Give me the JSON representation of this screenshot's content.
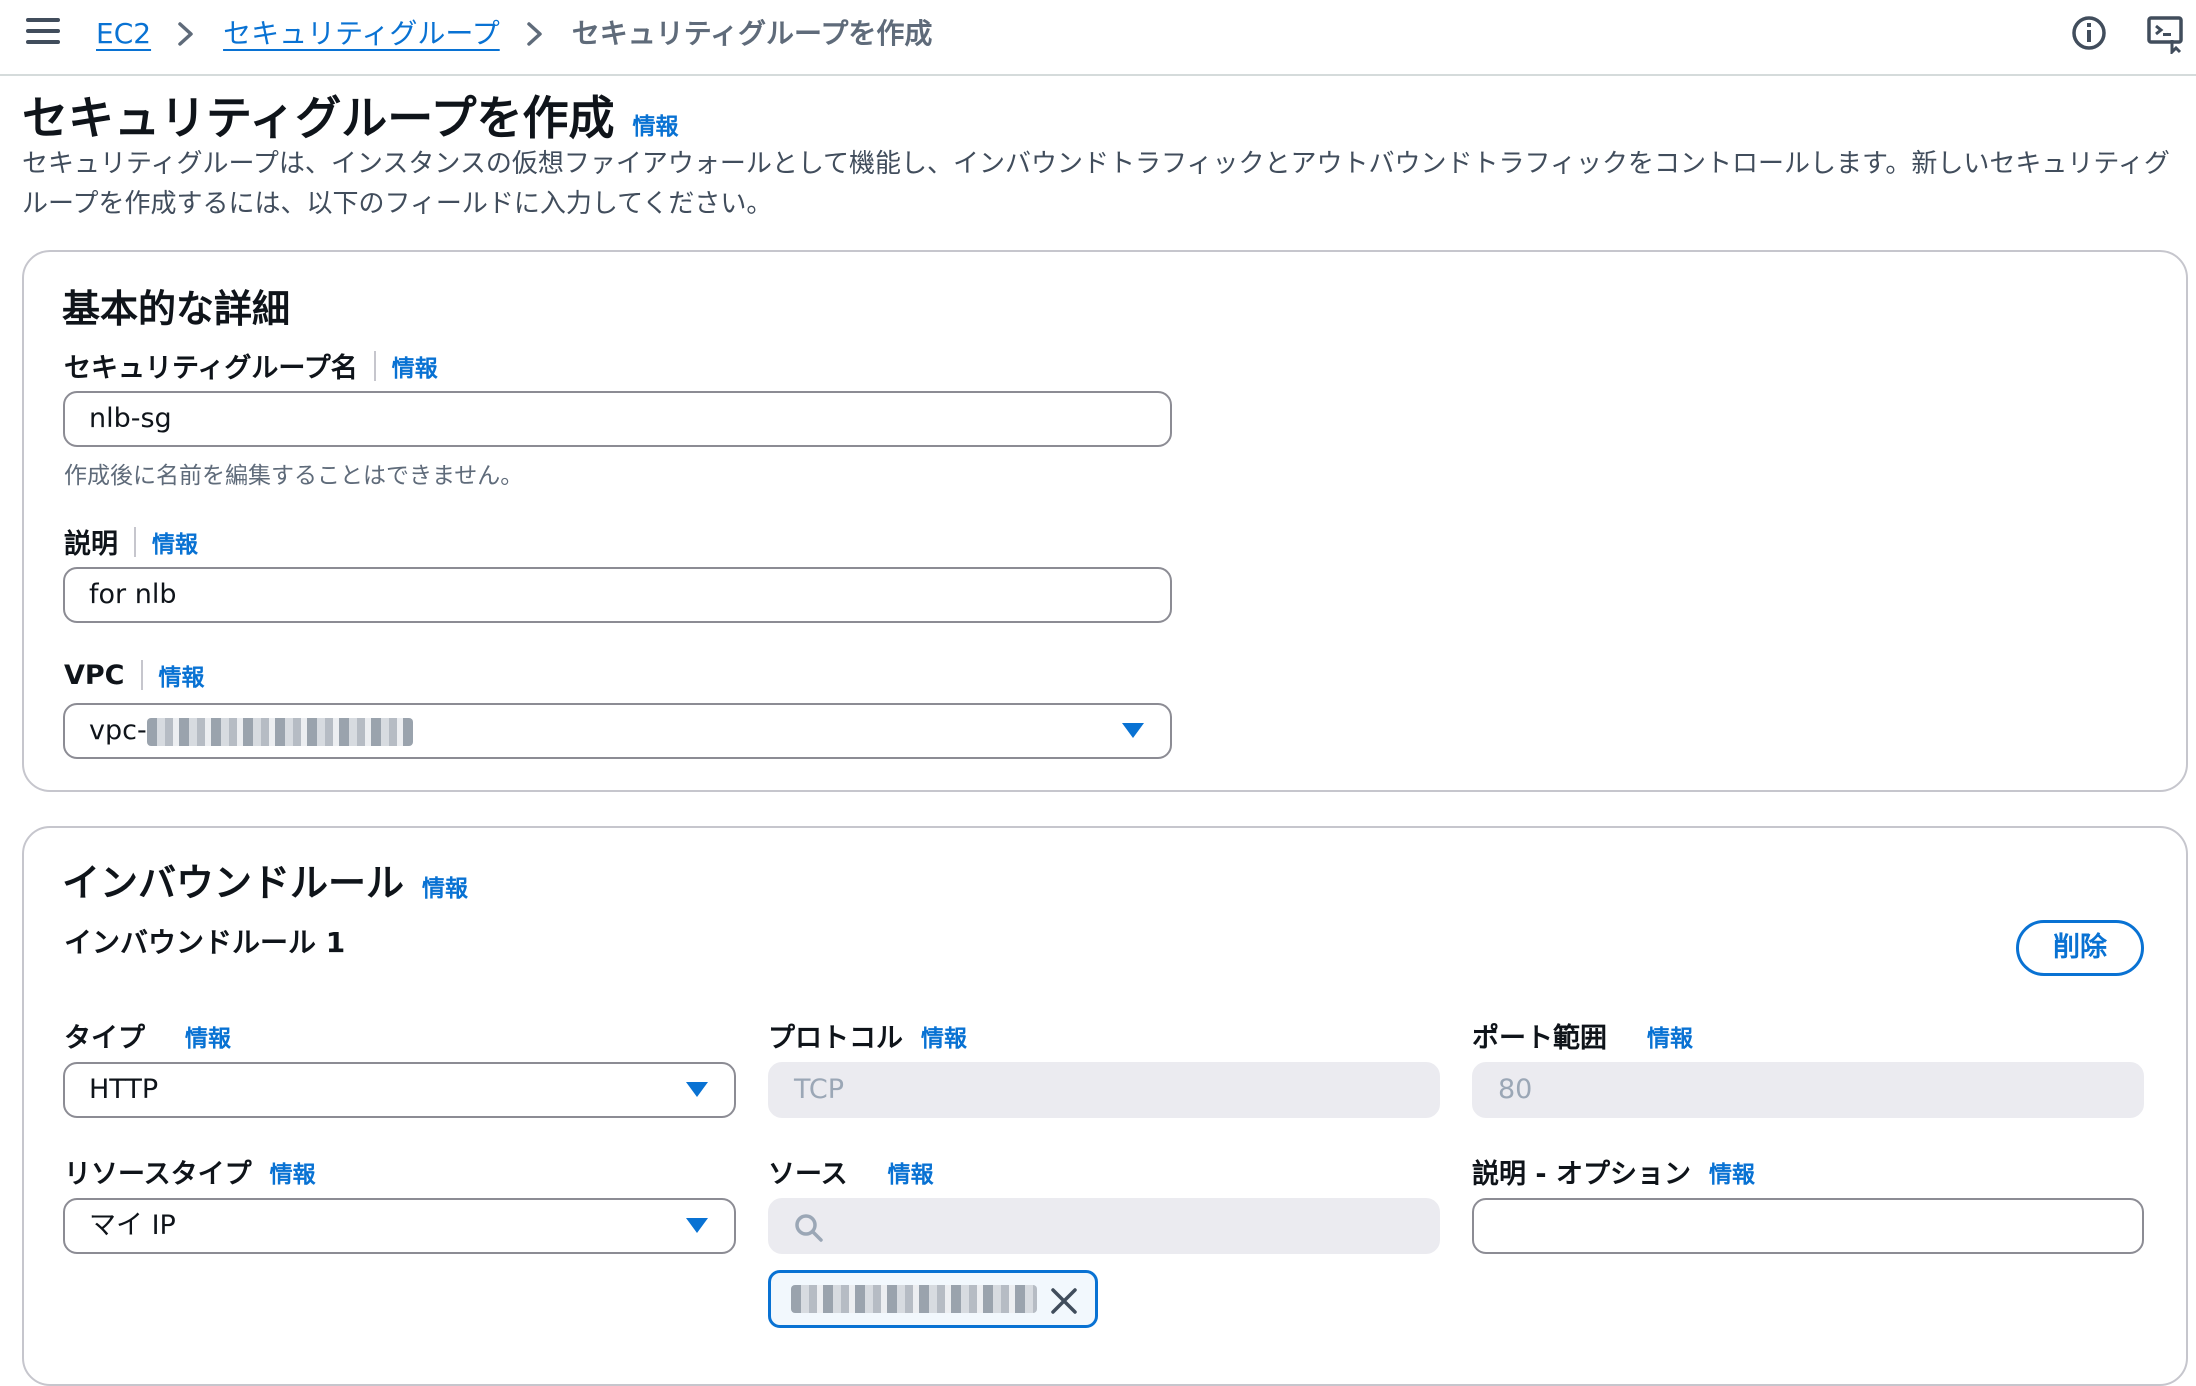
{
  "breadcrumb": {
    "items": [
      "EC2",
      "セキュリティグループ"
    ],
    "current": "セキュリティグループを作成"
  },
  "page": {
    "title": "セキュリティグループを作成",
    "info": "情報",
    "description": "セキュリティグループは、インスタンスの仮想ファイアウォールとして機能し、インバウンドトラフィックとアウトバウンドトラフィックをコントロールします。新しいセキュリティグループを作成するには、以下のフィールドに入力してください。"
  },
  "basic": {
    "title": "基本的な詳細",
    "name_label": "セキュリティグループ名",
    "name_info": "情報",
    "name_value": "nlb-sg",
    "name_hint": "作成後に名前を編集することはできません。",
    "desc_label": "説明",
    "desc_info": "情報",
    "desc_value": "for nlb",
    "vpc_label": "VPC",
    "vpc_info": "情報",
    "vpc_prefix": "vpc-"
  },
  "inbound": {
    "title": "インバウンドルール",
    "info": "情報",
    "rule_title": "インバウンドルール 1",
    "delete_label": "削除",
    "type_label": "タイプ",
    "type_info": "情報",
    "type_value": "HTTP",
    "protocol_label": "プロトコル",
    "protocol_info": "情報",
    "protocol_value": "TCP",
    "port_label": "ポート範囲",
    "port_info": "情報",
    "port_value": "80",
    "resource_label": "リソースタイプ",
    "resource_info": "情報",
    "resource_value": "マイ IP",
    "source_label": "ソース",
    "source_info": "情報",
    "optdesc_label": "説明 - オプション",
    "optdesc_info": "情報"
  },
  "colors": {
    "link": "#0972d3",
    "border": "#8c8c94",
    "disabled_bg": "#ebebf0"
  }
}
